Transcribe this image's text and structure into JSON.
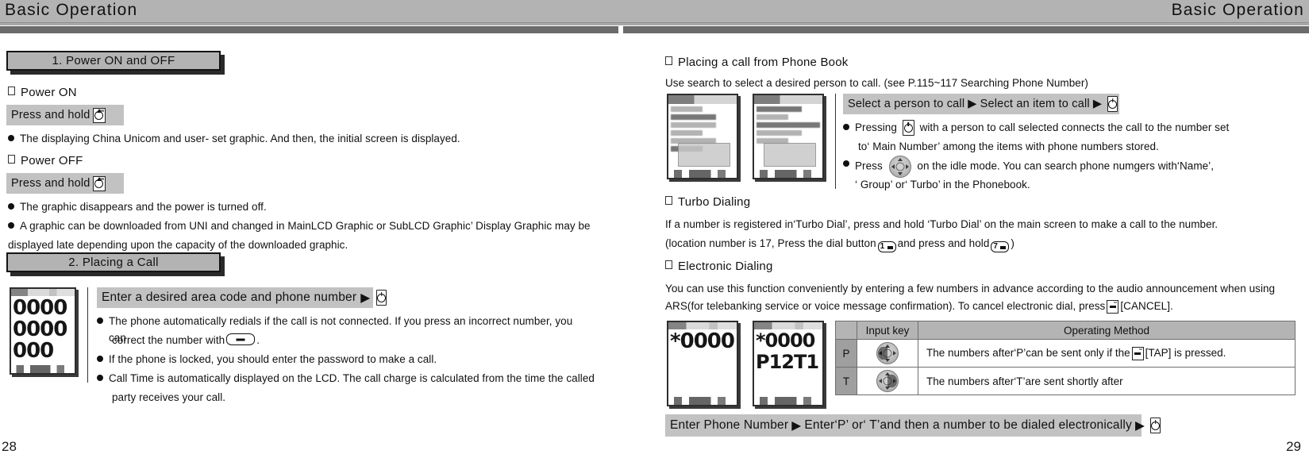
{
  "header": {
    "title_left": "Basic Operation",
    "title_right": "Basic Operation"
  },
  "left_page": {
    "page_number": "28",
    "sections": [
      {
        "box_label": "1. Power ON and OFF",
        "sub_power_on": "Power ON",
        "strip_power_on": "Press and hold",
        "bullet_power_on": "The displaying China Unicom and user- set graphic. And then, the initial screen is displayed.",
        "sub_power_off": "Power OFF",
        "strip_power_off": "Press and hold",
        "bullet_power_off_1": "The graphic disappears and the power is turned off.",
        "bullet_power_off_2a": "A graphic can be downloaded from UNI and changed in",
        "bullet_power_off_2b": "MainLCD Graphic or SubLCD Graphic’ Display Graphic may be",
        "bullet_power_off_2c": "displayed late depending upon the capacity of the downloaded graphic."
      },
      {
        "box_label": "2. Placing a Call",
        "strip_dial": "Enter a desired area code and phone number",
        "bullet_1a": "The phone automatically redials if the call is not connected. If you press an incorrect number, you can",
        "bullet_1b": "correct the number with",
        "bullet_1b_tail": ".",
        "bullet_2": "If the phone is locked, you should enter the password to make a call.",
        "bullet_3a": "Call Time is automatically displayed on the LCD. The call charge is calculated from the time the called",
        "bullet_3b": "party receives your call."
      }
    ],
    "lcd_digits": "00000000000"
  },
  "right_page": {
    "page_number": "29",
    "phonebook": {
      "heading": "Placing a call from Phone Book",
      "intro": "Use search to select a desired person to call. (see P.115~117 Searching Phone Number)",
      "strip_part1": "Select a person to call",
      "strip_part2": "Select an item to call",
      "bullet_1a": "Pressing",
      "bullet_1b": "with a person to call selected connects the call to the number set",
      "bullet_1c": "to‘ Main Number’ among the items with phone numbers stored.",
      "bullet_2a": "Press",
      "bullet_2b": "on the idle mode. You can search phone numgers with‘Name’,",
      "bullet_2c": "‘ Group’ or‘ Turbo’ in the Phonebook."
    },
    "turbo": {
      "heading": "Turbo Dialing",
      "line1": "If a number is registered in‘Turbo Dial’, press and hold ‘Turbo Dial’ on the main screen to make a call to the number.",
      "line2a": "(location number is 17, Press the dial button",
      "line2b": "and press and hold",
      "line2c": ")",
      "key1_label": "1",
      "key2_label": "7"
    },
    "electronic": {
      "heading": "Electronic Dialing",
      "line1": "You can use this function conveniently by entering a few numbers in advance according to the audio announcement when using",
      "line2a": "ARS(for telebanking service or voice message confirmation). To cancel electronic dial, press",
      "line2b": "[CANCEL].",
      "table": {
        "headers": [
          "",
          "Input key",
          "Operating Method"
        ],
        "rows": [
          {
            "label": "P",
            "key_icon": "navpad-left-icon",
            "method_a": "The numbers after‘P’can be sent only if the",
            "method_b": "[TAP] is pressed."
          },
          {
            "label": "T",
            "key_icon": "navpad-right-icon",
            "method_a": "The numbers after‘T’are sent shortly after",
            "method_b": ""
          }
        ]
      },
      "bottom_strip_part1": "Enter Phone Number",
      "bottom_strip_part2": "Enter‘P’ or‘ T’and then a number to be dialed electronically",
      "lcd_1": "*0000",
      "lcd_2_line1": "*0000",
      "lcd_2_line2": "P12T1"
    }
  },
  "colors": {
    "header_band": "#b3b3b3",
    "header_dark_rule": "#6b6b6b",
    "strip_gray": "#c2c2c2",
    "box_gray": "#b3b3b3",
    "table_header": "#b4b4b4",
    "table_rowlabel": "#9f9f9f"
  }
}
